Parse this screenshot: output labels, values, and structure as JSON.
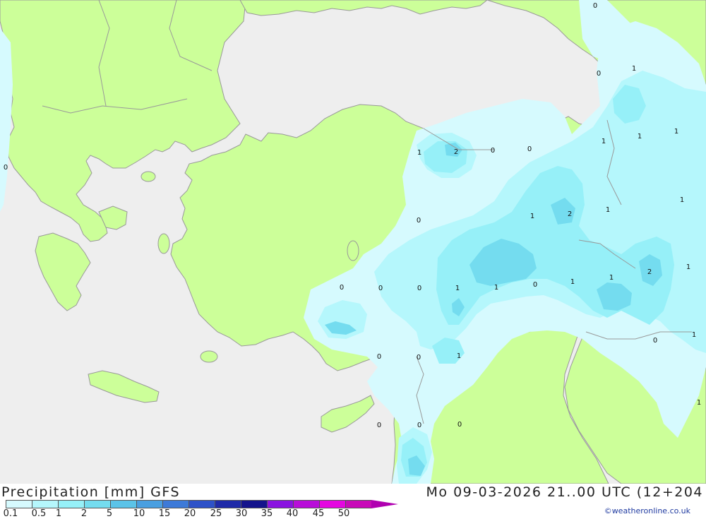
{
  "title": "Precipitation [mm] GFS",
  "valid_time": "Mo 09-03-2026 21..00 UTC (12+204",
  "credit": "©weatheronline.co.uk",
  "colors": {
    "sea": "#eeeeee",
    "land": "#ccff99",
    "border": "#999999"
  },
  "legend": {
    "ticks": [
      "0.1",
      "0.5",
      "1",
      "2",
      "5",
      "10",
      "15",
      "20",
      "25",
      "30",
      "35",
      "40",
      "45",
      "50"
    ],
    "swatches": [
      "#d6fafe",
      "#b5f7fc",
      "#96f0f8",
      "#74dcef",
      "#5cc3e8",
      "#4a9fe0",
      "#3d7ad8",
      "#2e52c8",
      "#1f2aa8",
      "#14148c",
      "#8a14e0",
      "#b80ed8",
      "#e408e0",
      "#c80bb8"
    ],
    "arrow_color": "#b000b0"
  },
  "value_labels": [
    {
      "text": "0"
    },
    {
      "text": "0"
    },
    {
      "text": "1"
    },
    {
      "text": "0"
    },
    {
      "text": "1"
    },
    {
      "text": "2"
    },
    {
      "text": "0"
    },
    {
      "text": "0"
    },
    {
      "text": "1"
    },
    {
      "text": "1"
    },
    {
      "text": "1"
    },
    {
      "text": "1"
    },
    {
      "text": "0"
    },
    {
      "text": "1"
    },
    {
      "text": "2"
    },
    {
      "text": "1"
    },
    {
      "text": "0"
    },
    {
      "text": "0"
    },
    {
      "text": "0"
    },
    {
      "text": "1"
    },
    {
      "text": "1"
    },
    {
      "text": "0"
    },
    {
      "text": "1"
    },
    {
      "text": "1"
    },
    {
      "text": "2"
    },
    {
      "text": "1"
    },
    {
      "text": "0"
    },
    {
      "text": "1"
    },
    {
      "text": "0"
    },
    {
      "text": "0"
    },
    {
      "text": "1"
    },
    {
      "text": "1"
    },
    {
      "text": "0"
    },
    {
      "text": "0"
    },
    {
      "text": "0"
    }
  ]
}
